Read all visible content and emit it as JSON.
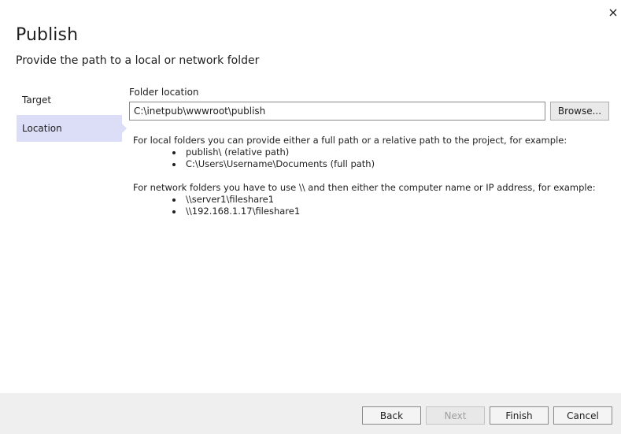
{
  "dialog": {
    "title": "Publish",
    "subtitle": "Provide the path to a local or network folder"
  },
  "nav": {
    "items": [
      {
        "label": "Target",
        "active": false
      },
      {
        "label": "Location",
        "active": true
      }
    ]
  },
  "location": {
    "label": "Folder location",
    "value": "C:\\inetpub\\wwwroot\\publish",
    "browse_label": "Browse..."
  },
  "help": {
    "local_intro": "For local folders you can provide either a full path or a relative path to the project, for example:",
    "local_examples": [
      "publish\\ (relative path)",
      "C:\\Users\\Username\\Documents (full path)"
    ],
    "network_intro": "For network folders you have to use \\\\ and then either the computer name or IP address, for example:",
    "network_examples": [
      "\\\\server1\\fileshare1",
      "\\\\192.168.1.17\\fileshare1"
    ]
  },
  "footer": {
    "back_label": "Back",
    "next_label": "Next",
    "finish_label": "Finish",
    "cancel_label": "Cancel"
  },
  "colors": {
    "accent_selection": "#dcdef7",
    "footer_bg": "#efefef"
  }
}
